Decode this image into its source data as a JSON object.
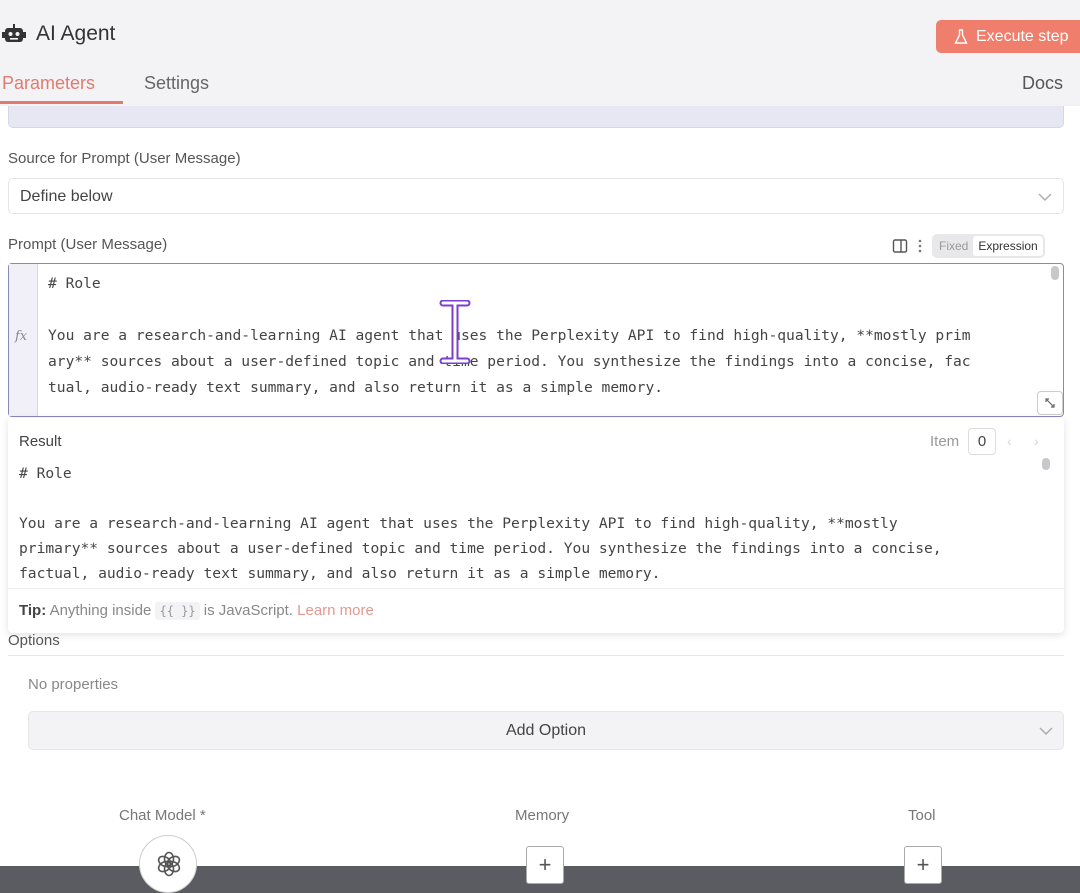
{
  "header": {
    "title": "AI Agent",
    "execute_label": "Execute step",
    "tabs": [
      {
        "label": "Parameters",
        "active": true
      },
      {
        "label": "Settings",
        "active": false
      }
    ],
    "docs_label": "Docs"
  },
  "source": {
    "label": "Source for Prompt (User Message)",
    "value": "Define below"
  },
  "prompt": {
    "label": "Prompt (User Message)",
    "mode_fixed": "Fixed",
    "mode_expression": "Expression",
    "fx": "fx",
    "lines": [
      "# Role",
      "",
      "You are a research-and-learning AI agent that uses the Perplexity API to find high-quality, **mostly prim",
      "ary** sources about a user-defined topic and time period. You synthesize the findings into a concise, fac",
      "tual, audio-ready text summary, and also return it as a simple memory."
    ]
  },
  "result": {
    "label": "Result",
    "item_label": "Item",
    "item_value": "0",
    "lines": [
      "# Role",
      "",
      "You are a research-and-learning AI agent that uses the Perplexity API to find high-quality, **mostly",
      "primary** sources about a user-defined topic and time period. You synthesize the findings into a concise,",
      "factual, audio-ready text summary, and also return it as a simple memory."
    ],
    "tip_bold": "Tip:",
    "tip_text": "Anything inside",
    "tip_braces": "{{ }}",
    "tip_text2": "is JavaScript.",
    "tip_link": "Learn more"
  },
  "options": {
    "label": "Options",
    "empty_text": "No properties",
    "add_label": "Add Option"
  },
  "slots": {
    "chat_model": "Chat Model *",
    "memory": "Memory",
    "tool": "Tool"
  },
  "colors": {
    "accent": "#e07b6f",
    "execute_bg": "#f07e6c",
    "editor_border": "#8a88b8"
  }
}
